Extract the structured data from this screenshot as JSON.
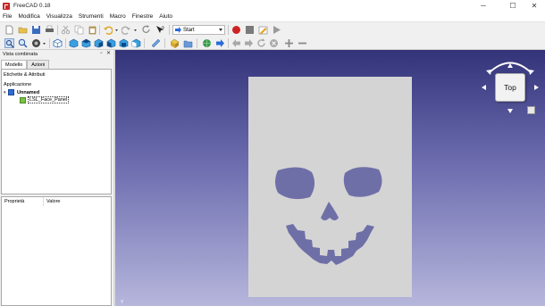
{
  "window": {
    "title": "FreeCAD 0.18",
    "minimize": "─",
    "maximize": "☐",
    "close": "✕"
  },
  "menu": [
    "File",
    "Modifica",
    "Visualizza",
    "Strumenti",
    "Macro",
    "Finestre",
    "Aiuto"
  ],
  "workbench": {
    "selected": "Start"
  },
  "dock": {
    "title": "Vista combinata",
    "float_btn": "▫",
    "close_btn": "✕",
    "tabs": [
      "Modello",
      "Azioni"
    ],
    "tree_header": "Etichette & Attributi",
    "category": "Applicazione",
    "document": "Unnamed",
    "object": "LSL_Face_Panel",
    "properties_col": "Proprietà",
    "value_col": "Valore"
  },
  "navcube": {
    "face": "Top"
  },
  "axis_label": "Y",
  "colors": {
    "record": "#cc2222",
    "stop": "#7a7a7a",
    "panel": "#d4d4d4",
    "cutout": "#6f6fa8",
    "viewport_top": "#33337a",
    "viewport_bottom": "#b6b6dc"
  }
}
